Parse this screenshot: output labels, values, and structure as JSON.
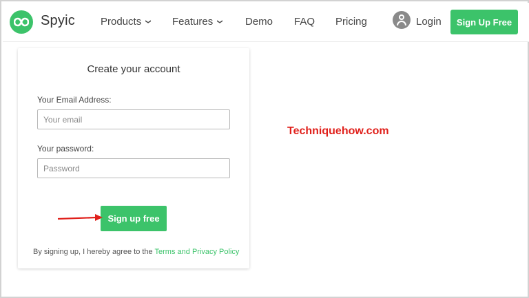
{
  "header": {
    "brand": "Spyic",
    "nav": {
      "products": "Products",
      "features": "Features",
      "demo": "Demo",
      "faq": "FAQ",
      "pricing": "Pricing"
    },
    "chevron": "❯",
    "login": "Login",
    "signup": "Sign Up Free"
  },
  "form": {
    "title": "Create your account",
    "email_label": "Your Email Address:",
    "email_placeholder": "Your email",
    "password_label": "Your password:",
    "password_placeholder": "Password",
    "submit": "Sign up free",
    "terms_prefix": "By signing up, I hereby agree to the ",
    "terms_link": "Terms and Privacy Policy"
  },
  "watermark": "Techniquehow.com",
  "colors": {
    "accent": "#3cc36a",
    "annotation": "#e0201b"
  }
}
